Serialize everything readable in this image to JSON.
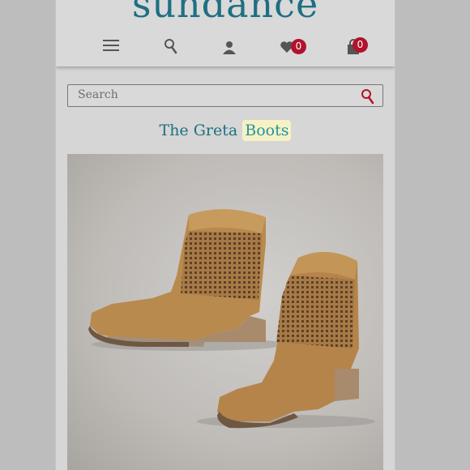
{
  "header": {
    "logo_text": "sundance",
    "icons": [
      "menu-icon",
      "search-icon",
      "account-icon",
      "heart-icon",
      "shopping-bag-icon"
    ],
    "wishlist_count": "0",
    "cart_count": "0"
  },
  "search": {
    "placeholder": "Search",
    "icon": "search-icon"
  },
  "product": {
    "title_part1": "The Greta",
    "title_highlight": "Boots",
    "image_subject": "pair of tan perforated suede ankle boots"
  },
  "colors": {
    "brand": "#1f6f82",
    "badge": "#b0132c",
    "highlight": "#f6f2c5",
    "boot_suede": "#b98a4e"
  }
}
